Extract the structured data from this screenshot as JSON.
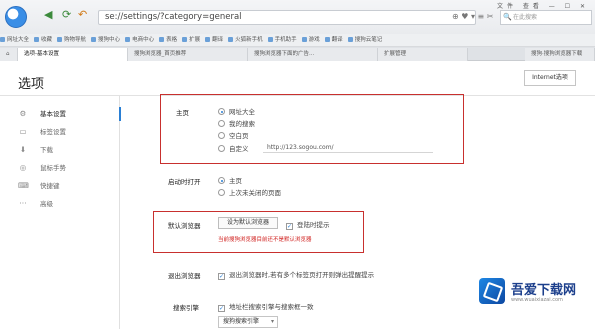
{
  "browser": {
    "address": "se://settings/?category=general",
    "search_placeholder": "在此搜索",
    "window_controls": "文件 查看 — ☐ ✕",
    "bookmarks": [
      "网址大全",
      "收藏",
      "购物导航",
      "搜狗中心",
      "电商中心",
      "表格",
      "扩展",
      "翻译",
      "火狐新手机",
      "手机助手",
      "游戏",
      "翻译",
      "搜狗云笔记"
    ],
    "tabs": [
      "选项-基本设置",
      "搜狗浏览器_首页推荐",
      "搜狗浏览器下面的广告...",
      "扩展管理"
    ],
    "more_tab": "搜狗·搜狗浏览器下载",
    "address_icons": "⊕ ♥ ▾ ≡ ✂"
  },
  "page": {
    "title": "选项",
    "internet_options": "Internet选项"
  },
  "sidebar": [
    {
      "icon": "gear-icon",
      "glyph": "⚙",
      "label": "基本设置",
      "active": true
    },
    {
      "icon": "tab-icon",
      "glyph": "▭",
      "label": "标签设置",
      "active": false
    },
    {
      "icon": "download-icon",
      "glyph": "⬇",
      "label": "下载",
      "active": false
    },
    {
      "icon": "mouse-icon",
      "glyph": "◎",
      "label": "鼠标手势",
      "active": false
    },
    {
      "icon": "shortcut-icon",
      "glyph": "⌨",
      "label": "快捷键",
      "active": false
    },
    {
      "icon": "more-icon",
      "glyph": "···",
      "label": "高级",
      "active": false
    }
  ],
  "homepage": {
    "label": "主页",
    "options": [
      "网址大全",
      "我的搜索",
      "空白页",
      "自定义"
    ],
    "selected": 0,
    "custom_url": "http://123.sogou.com/"
  },
  "startup": {
    "label": "启动时打开",
    "options": [
      "主页",
      "上次未关闭的页面"
    ],
    "selected": 0
  },
  "default_browser": {
    "label": "默认浏览器",
    "button": "设为默认浏览器",
    "check_label": "登陆时提示",
    "warning": "当前搜狗浏览器目前还不是默认浏览器"
  },
  "exit_browser": {
    "label": "退出浏览器",
    "check_label": "退出浏览器时,若有多个标签页打开则弹出提醒提示"
  },
  "search_engine": {
    "label": "搜索引擎",
    "check_label": "地址栏搜索引擎与搜索框一致",
    "select_value": "搜狗搜索引擎"
  },
  "watermark": {
    "brand": "吾爱下载网",
    "url": "www.wuaixiazai.com"
  },
  "colors": {
    "highlight_box": "#c8302e",
    "accent": "#2a7fd4",
    "warning_text": "#d0201e"
  }
}
